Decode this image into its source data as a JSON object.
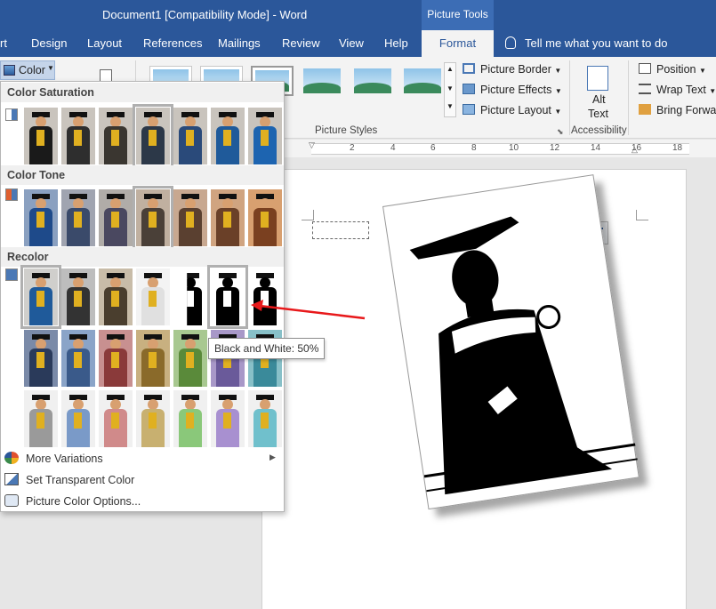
{
  "titlebar": {
    "doc_title": "Document1 [Compatibility Mode]  -  Word",
    "context_tab": "Picture Tools"
  },
  "tabs": [
    "rt",
    "Design",
    "Layout",
    "References",
    "Mailings",
    "Review",
    "View",
    "Help",
    "Format"
  ],
  "tell_me": "Tell me what you want to do",
  "ribbon": {
    "color_button": "Color",
    "picture_border": "Picture Border",
    "picture_effects": "Picture Effects",
    "picture_layout": "Picture Layout",
    "picture_styles_label": "Picture Styles",
    "alt_text_line1": "Alt",
    "alt_text_line2": "Text",
    "accessibility_label": "Accessibility",
    "position": "Position",
    "wrap_text": "Wrap Text",
    "bring_forward": "Bring Forwar"
  },
  "ruler_numbers": [
    "2",
    "4",
    "6",
    "8",
    "10",
    "12",
    "14",
    "16",
    "18"
  ],
  "panel": {
    "color_saturation": "Color Saturation",
    "color_tone": "Color Tone",
    "recolor": "Recolor",
    "more_variations": "More Variations",
    "set_transparent_color": "Set Transparent Color",
    "picture_color_options": "Picture Color Options...",
    "saturation_colors": [
      "#1a1a1a",
      "#2e2e2e",
      "#3a3630",
      "#2c3848",
      "#2a4a7a",
      "#1f5a9a",
      "#1d64b0"
    ],
    "tone_colors": [
      "#1e4a8a",
      "#3a4a6a",
      "#4a4860",
      "#4a4038",
      "#5a4030",
      "#6a4028",
      "#7a4020"
    ],
    "recolor_row2": [
      "#2a3a5a",
      "#3a5a8a",
      "#8a3a3a",
      "#8a6a2a",
      "#5a8a3a",
      "#6a5a9a",
      "#3a8a9a"
    ],
    "recolor_row3": [
      "#9a9a9a",
      "#7a9ac8",
      "#d08a8a",
      "#c8b070",
      "#8ac87a",
      "#a890d0",
      "#70c0cc"
    ],
    "recolor_row3_extra": "#d08040"
  },
  "tooltip": "Black and White: 50%",
  "colors": {
    "title_bar": "#2b579a",
    "ribbon": "#f3f3f3",
    "arrow": "#e8191b"
  }
}
